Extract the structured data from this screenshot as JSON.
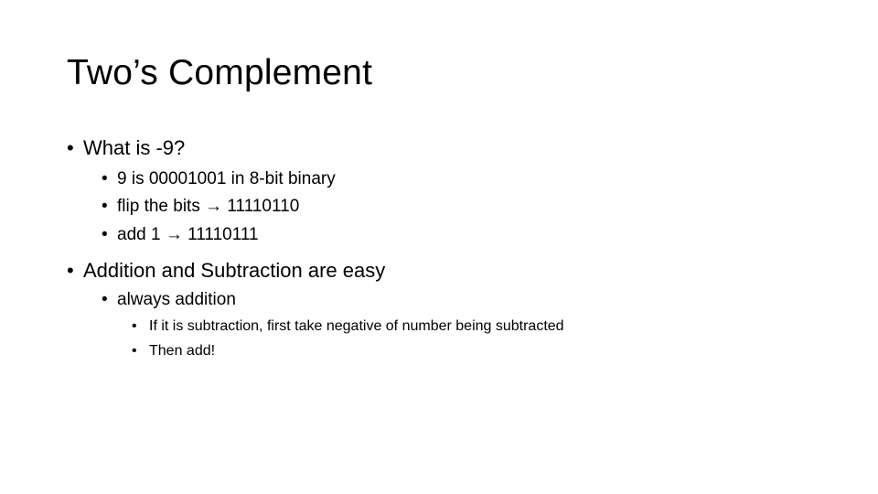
{
  "slide": {
    "title": "Two’s Complement",
    "bullet_glyph": "•",
    "items": [
      {
        "level": 1,
        "text": "What is -9?"
      },
      {
        "level": 2,
        "text": "9 is 00001001 in 8-bit binary"
      },
      {
        "level": 2,
        "text": "flip the bits → 11110110"
      },
      {
        "level": 2,
        "text": "add 1 → 11110111"
      },
      {
        "level": 1,
        "text": "Addition and Subtraction are easy"
      },
      {
        "level": 2,
        "text": "always addition"
      },
      {
        "level": 3,
        "text": "If it is subtraction, first take negative of number being subtracted"
      },
      {
        "level": 3,
        "text": "Then add!"
      }
    ]
  }
}
